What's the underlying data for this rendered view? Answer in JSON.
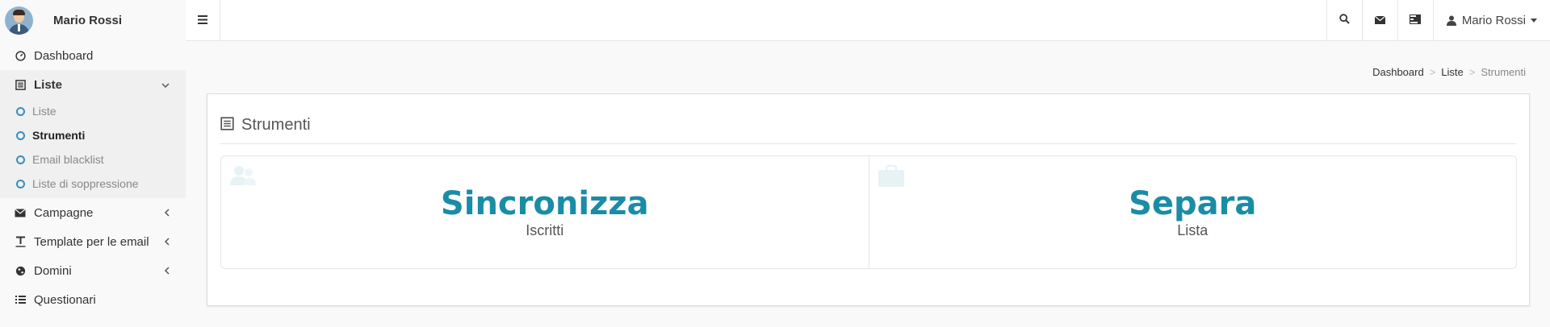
{
  "sidebar": {
    "user_name": "Mario Rossi",
    "items": [
      {
        "label": "Dashboard",
        "icon": "dashboard-icon"
      },
      {
        "label": "Liste",
        "icon": "list-alt-icon",
        "sub": [
          {
            "label": "Liste"
          },
          {
            "label": "Strumenti"
          },
          {
            "label": "Email blacklist"
          },
          {
            "label": "Liste di soppressione"
          }
        ]
      },
      {
        "label": "Campagne",
        "icon": "envelope-icon"
      },
      {
        "label": "Template per le email",
        "icon": "text-icon"
      },
      {
        "label": "Domini",
        "icon": "globe-icon"
      },
      {
        "label": "Questionari",
        "icon": "list-icon"
      }
    ]
  },
  "topbar": {
    "user_label": "Mario Rossi"
  },
  "breadcrumb": {
    "items": [
      "Dashboard",
      "Liste",
      "Strumenti"
    ],
    "separator": ">"
  },
  "panel": {
    "title": "Strumenti",
    "tiles": [
      {
        "title": "Sincronizza",
        "subtitle": "Iscritti"
      },
      {
        "title": "Separa",
        "subtitle": "Lista"
      }
    ]
  },
  "colors": {
    "accent": "#1a8ca6",
    "sub_circle": "#3c8dbc"
  }
}
